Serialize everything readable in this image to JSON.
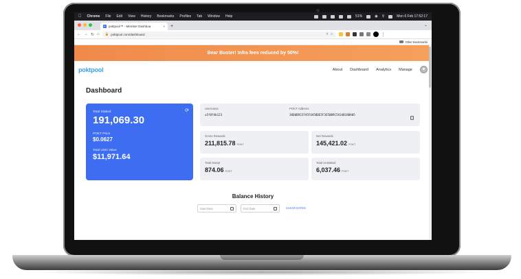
{
  "menubar": {
    "app": "Chrome",
    "menus": [
      "File",
      "Edit",
      "View",
      "History",
      "Bookmarks",
      "Profiles",
      "Tab",
      "Window",
      "Help"
    ],
    "battery": "51%",
    "clock": "Mon 6 Feb  17:52:17"
  },
  "browser": {
    "tab_title": "poktpool™ - Member Dashboa",
    "url": "poktpool.com/dashboard",
    "bookmarks_label": "Other Bookmarks"
  },
  "banner": {
    "text": "Bear Buster! Infra fees reduced by 50%!"
  },
  "nav": {
    "logo": "poktpool",
    "links": [
      "About",
      "Dashboard",
      "Analytics",
      "Manage"
    ]
  },
  "dashboard": {
    "title": "Dashboard",
    "total_staked_label": "Total Staked",
    "total_staked": "191,069.30",
    "pokt_price_label": "POKT Price",
    "pokt_price": "$0.0627",
    "total_usd_label": "Total USD Value",
    "total_usd": "$11,971.64",
    "username_label": "Username",
    "username": "u5f8f4b123",
    "address_label": "POKT Address",
    "address": "38D0B9237A5F4A5BDE5F3E50B9C5A34B18BA05",
    "gross_label": "Gross Rewards",
    "gross": "211,815.78",
    "net_label": "Net Rewards",
    "net": "145,421.02",
    "swept_label": "Total Swept",
    "swept": "874.06",
    "unstaked_label": "Total Unstaked",
    "unstaked": "6,037.46",
    "unit": "POKT"
  },
  "balance": {
    "title": "Balance History",
    "start_placeholder": "Start Date",
    "end_placeholder": "End Date",
    "clear": "CLEAR DATES"
  }
}
